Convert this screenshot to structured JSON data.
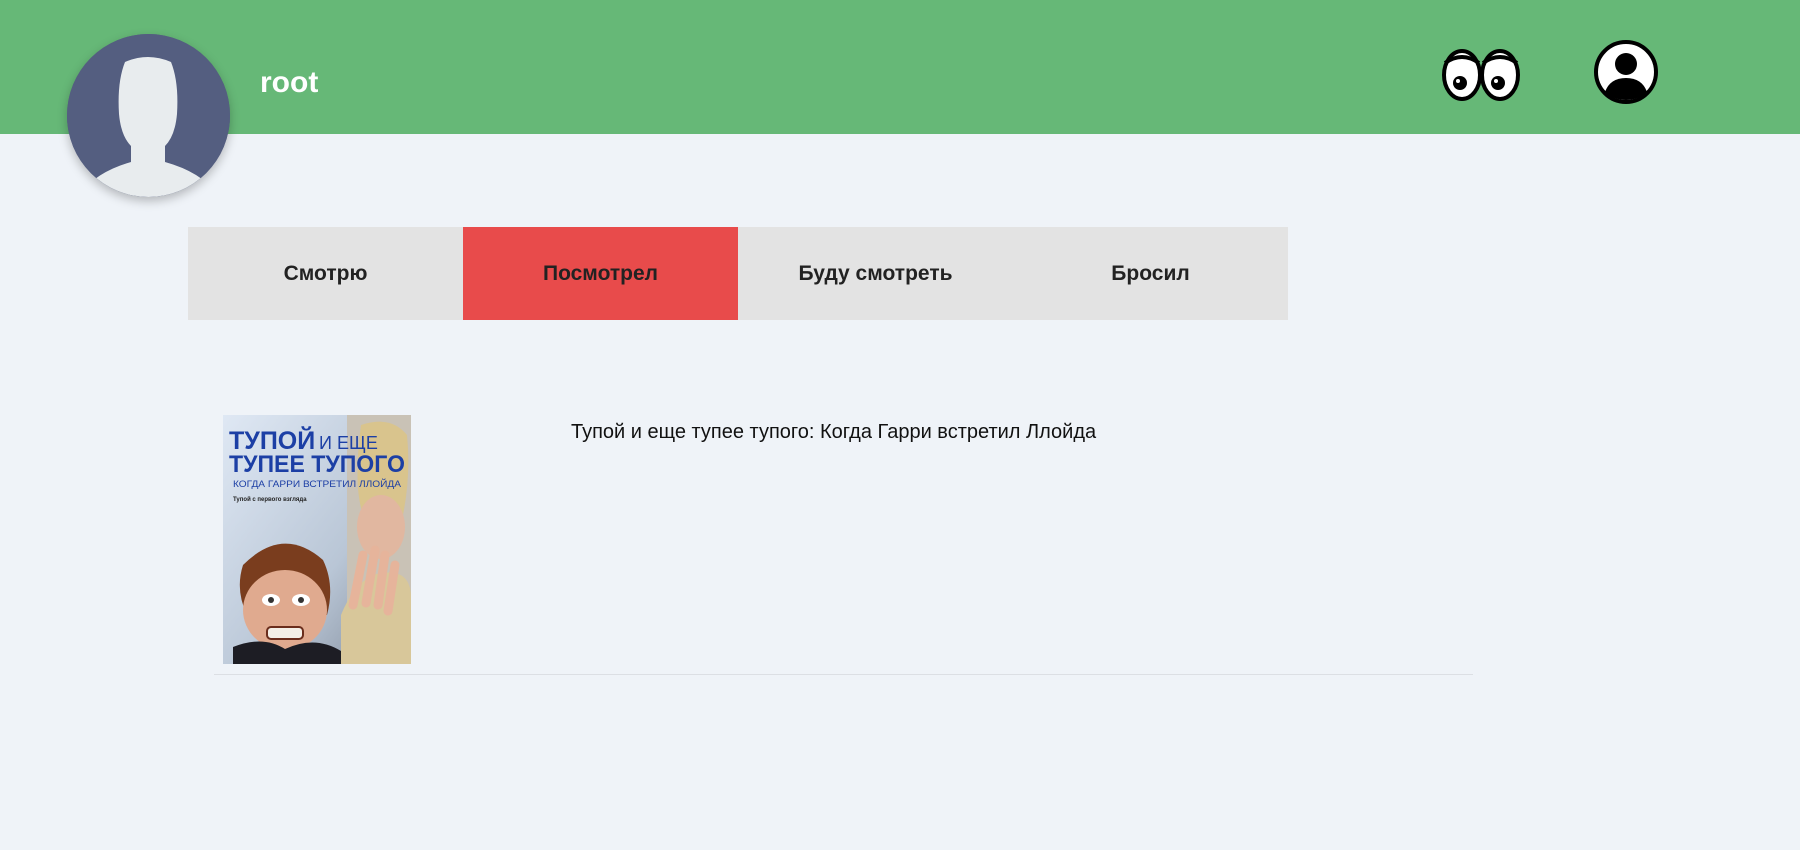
{
  "header": {
    "username": "root",
    "background_color": "#66b877",
    "icons": [
      "avatar-placeholder",
      "eyes-icon",
      "user-circle-icon"
    ]
  },
  "tabs": [
    {
      "label": "Смотрю",
      "active": false
    },
    {
      "label": "Посмотрел",
      "active": true
    },
    {
      "label": "Буду смотреть",
      "active": false
    },
    {
      "label": "Бросил",
      "active": false
    }
  ],
  "active_tab_color": "#e84b4b",
  "movies": [
    {
      "title": "Тупой и еще тупее тупого: Когда Гарри встретил Ллойда",
      "poster": {
        "title_line1": "ТУПОЙ",
        "title_line1_small": "И ЕЩЕ",
        "title_line2": "ТУПЕЕ ТУПОГО",
        "subtitle": "КОГДА ГАРРИ ВСТРЕТИЛ ЛЛОЙДА",
        "tagline": "Тупой с первого взгляда"
      }
    }
  ]
}
